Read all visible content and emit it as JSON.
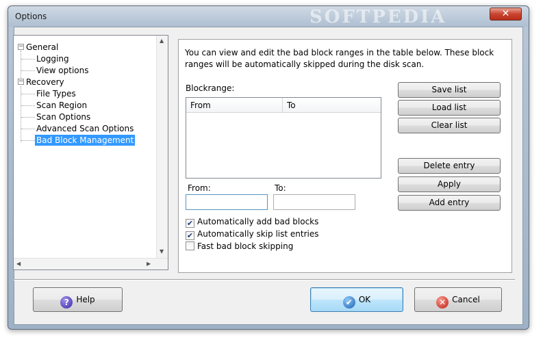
{
  "window": {
    "title": "Options",
    "watermark": "SOFTPEDIA",
    "close_glyph": "✕"
  },
  "tree": {
    "items": [
      {
        "label": "General",
        "expander": "−"
      },
      {
        "label": "Logging"
      },
      {
        "label": "View options"
      },
      {
        "label": "Recovery",
        "expander": "−"
      },
      {
        "label": "File Types"
      },
      {
        "label": "Scan Region"
      },
      {
        "label": "Scan Options"
      },
      {
        "label": "Advanced Scan Options"
      },
      {
        "label": "Bad Block Management",
        "selected": true
      }
    ]
  },
  "panel": {
    "description": "You can view and edit the bad block ranges in the table below. These block ranges will be automatically skipped during the disk scan.",
    "blockrange_label": "Blockrange:",
    "columns": [
      "From",
      "To"
    ],
    "from_label": "From:",
    "to_label": "To:",
    "from_value": "",
    "to_value": "",
    "checkboxes": [
      {
        "label": "Automatically add bad blocks",
        "checked": true,
        "mark": "✔"
      },
      {
        "label": "Automatically skip list entries",
        "checked": true,
        "mark": "✔"
      },
      {
        "label": "Fast bad block skipping",
        "checked": false,
        "mark": ""
      }
    ],
    "buttons": {
      "save_list": "Save list",
      "load_list": "Load list",
      "clear_list": "Clear list",
      "delete_entry": "Delete entry",
      "apply": "Apply",
      "add_entry": "Add entry"
    }
  },
  "footer": {
    "help": "Help",
    "ok": "OK",
    "cancel": "Cancel",
    "help_glyph": "?",
    "ok_glyph": "✔",
    "cancel_glyph": "✕"
  },
  "colors": {
    "selection": "#3399ff",
    "close_button": "#c9442f"
  }
}
